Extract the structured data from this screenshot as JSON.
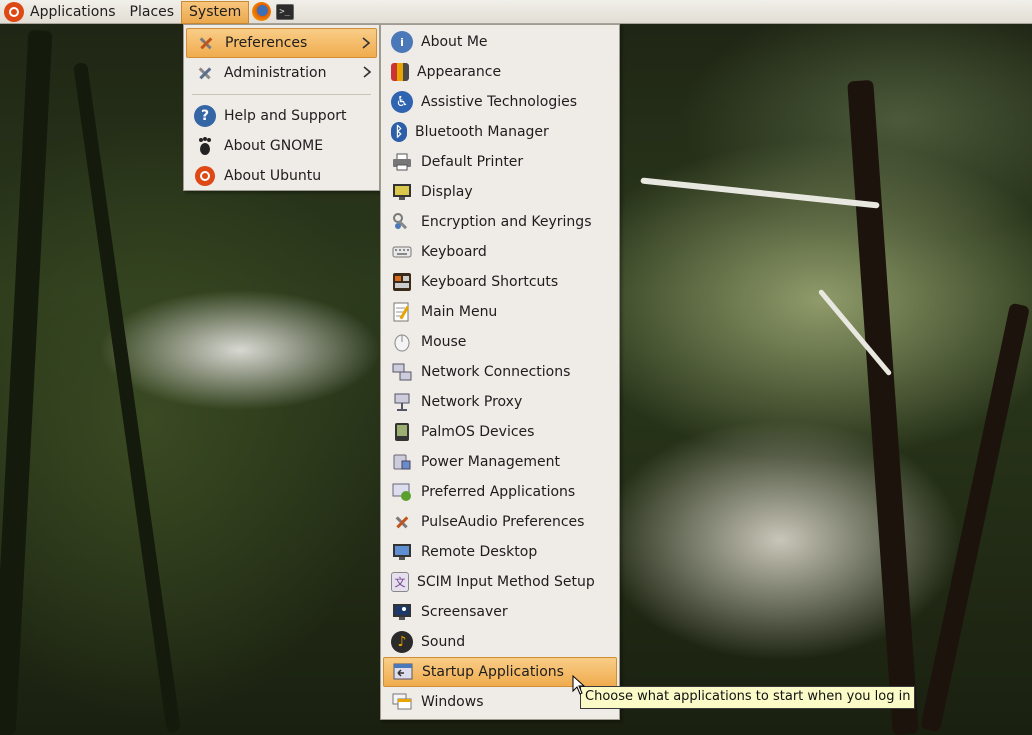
{
  "panel": {
    "applications": "Applications",
    "places": "Places",
    "system": "System",
    "launchers": [
      "firefox-icon",
      "terminal-icon"
    ]
  },
  "system_menu": {
    "items": [
      {
        "label": "Preferences",
        "icon": "preferences-icon",
        "submenu": true,
        "highlighted": true
      },
      {
        "label": "Administration",
        "icon": "administration-icon",
        "submenu": true
      },
      {
        "label": "Help and Support",
        "icon": "help-icon"
      },
      {
        "label": "About GNOME",
        "icon": "gnome-foot-icon"
      },
      {
        "label": "About Ubuntu",
        "icon": "ubuntu-icon"
      }
    ]
  },
  "preferences_menu": {
    "items": [
      {
        "label": "About Me",
        "icon": "about-me-icon"
      },
      {
        "label": "Appearance",
        "icon": "appearance-icon"
      },
      {
        "label": "Assistive Technologies",
        "icon": "accessibility-icon"
      },
      {
        "label": "Bluetooth Manager",
        "icon": "bluetooth-icon"
      },
      {
        "label": "Default Printer",
        "icon": "printer-icon"
      },
      {
        "label": "Display",
        "icon": "display-icon"
      },
      {
        "label": "Encryption and Keyrings",
        "icon": "keyring-icon"
      },
      {
        "label": "Keyboard",
        "icon": "keyboard-icon"
      },
      {
        "label": "Keyboard Shortcuts",
        "icon": "keyboard-shortcuts-icon"
      },
      {
        "label": "Main Menu",
        "icon": "main-menu-icon"
      },
      {
        "label": "Mouse",
        "icon": "mouse-icon"
      },
      {
        "label": "Network Connections",
        "icon": "network-connections-icon"
      },
      {
        "label": "Network Proxy",
        "icon": "network-proxy-icon"
      },
      {
        "label": "PalmOS Devices",
        "icon": "palm-device-icon"
      },
      {
        "label": "Power Management",
        "icon": "power-icon"
      },
      {
        "label": "Preferred Applications",
        "icon": "preferred-apps-icon"
      },
      {
        "label": "PulseAudio Preferences",
        "icon": "pulseaudio-icon"
      },
      {
        "label": "Remote Desktop",
        "icon": "remote-desktop-icon"
      },
      {
        "label": "SCIM Input Method Setup",
        "icon": "scim-icon"
      },
      {
        "label": "Screensaver",
        "icon": "screensaver-icon"
      },
      {
        "label": "Sound",
        "icon": "sound-icon"
      },
      {
        "label": "Startup Applications",
        "icon": "startup-apps-icon",
        "highlighted": true
      },
      {
        "label": "Windows",
        "icon": "windows-icon"
      }
    ]
  },
  "tooltip": "Choose what applications to start when you log in",
  "colors": {
    "highlight": "#f0ac4e",
    "menu_bg": "#efebe6",
    "ubuntu_orange": "#dd4814"
  }
}
